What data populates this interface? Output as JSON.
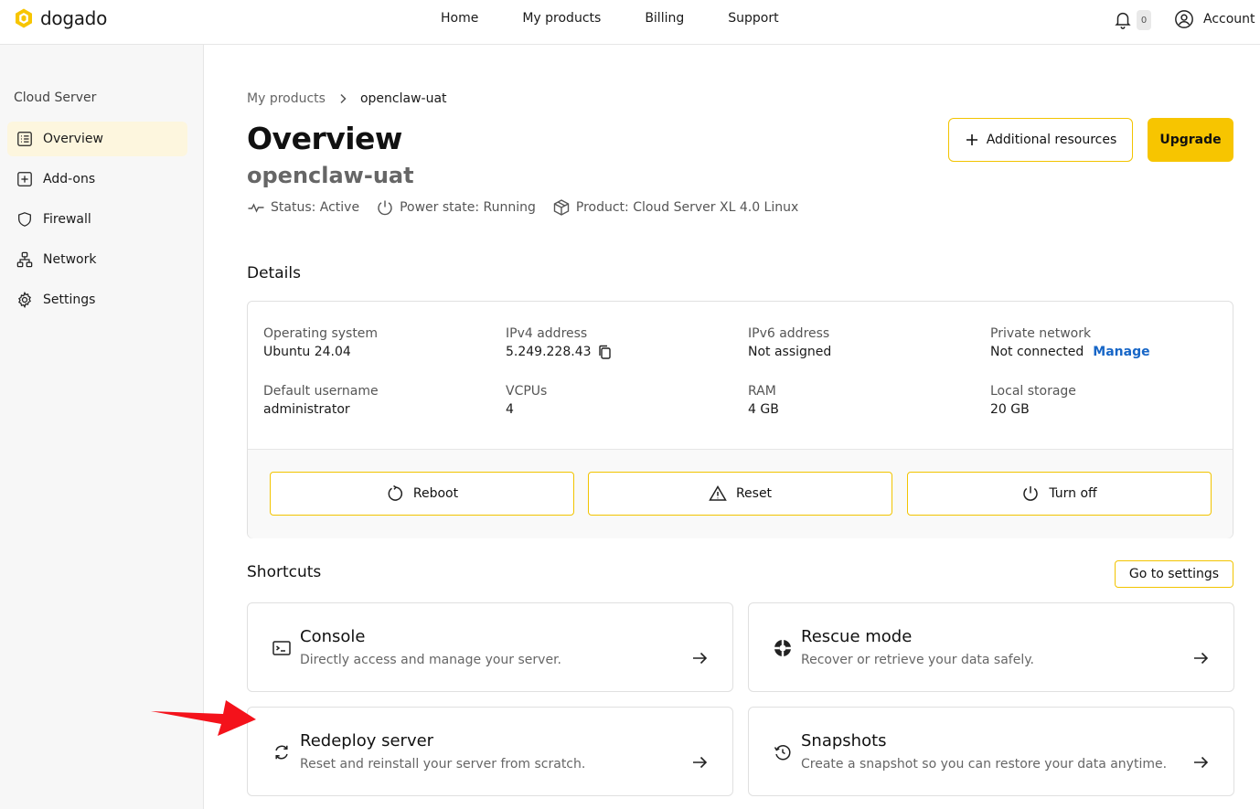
{
  "brand": {
    "name": "dogado",
    "accent": "#f7c500",
    "link": "#1766c7"
  },
  "nav": {
    "items": [
      "Home",
      "My products",
      "Billing",
      "Support"
    ]
  },
  "header": {
    "notification_count": "0",
    "account_label": "Account"
  },
  "sidebar": {
    "title": "Cloud Server",
    "items": [
      {
        "label": "Overview",
        "icon": "list-icon",
        "active": true
      },
      {
        "label": "Add-ons",
        "icon": "plus-square-icon"
      },
      {
        "label": "Firewall",
        "icon": "shield-icon"
      },
      {
        "label": "Network",
        "icon": "network-icon"
      },
      {
        "label": "Settings",
        "icon": "gear-icon"
      }
    ]
  },
  "breadcrumb": {
    "parent": "My products",
    "current": "openclaw-uat"
  },
  "page": {
    "title": "Overview",
    "subtitle": "openclaw-uat",
    "status": "Status: Active",
    "power": "Power state: Running",
    "product": "Product: Cloud Server XL 4.0 Linux",
    "additional_resources_label": "Additional resources",
    "upgrade_label": "Upgrade"
  },
  "details": {
    "title": "Details",
    "fields": [
      {
        "label": "Operating system",
        "value": "Ubuntu 24.04"
      },
      {
        "label": "IPv4 address",
        "value": "5.249.228.43"
      },
      {
        "label": "IPv6 address",
        "value": "Not assigned"
      },
      {
        "label": "Private network",
        "value": "Not connected",
        "link": "Manage"
      },
      {
        "label": "Default username",
        "value": "administrator"
      },
      {
        "label": "VCPUs",
        "value": "4"
      },
      {
        "label": "RAM",
        "value": "4 GB"
      },
      {
        "label": "Local storage",
        "value": "20 GB"
      }
    ],
    "actions": [
      "Reboot",
      "Reset",
      "Turn off"
    ]
  },
  "shortcuts": {
    "title": "Shortcuts",
    "goto_label": "Go to settings",
    "cards": [
      {
        "title": "Console",
        "desc": "Directly access and manage your server."
      },
      {
        "title": "Rescue mode",
        "desc": "Recover or retrieve your data safely."
      },
      {
        "title": "Redeploy server",
        "desc": "Reset and reinstall your server from scratch."
      },
      {
        "title": "Snapshots",
        "desc": "Create a snapshot so you can restore your data anytime."
      }
    ]
  }
}
